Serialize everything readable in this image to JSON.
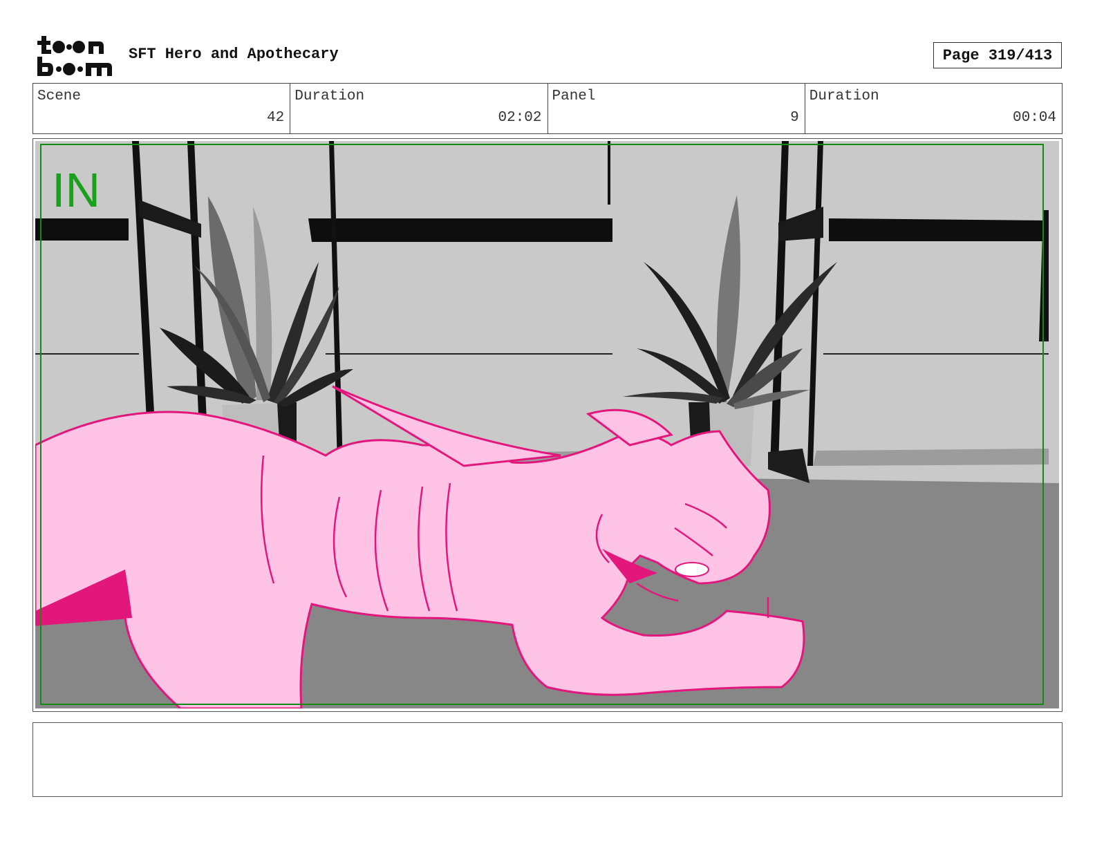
{
  "header": {
    "logo_text": "toon boom",
    "title": "SFT Hero and Apothecary",
    "page": "Page 319/413"
  },
  "info": {
    "scene_label": "Scene",
    "scene_value": "42",
    "scene_duration_label": "Duration",
    "scene_duration_value": "02:02",
    "panel_label": "Panel",
    "panel_value": "9",
    "panel_duration_label": "Duration",
    "panel_duration_value": "00:04"
  },
  "frame": {
    "transition_label": "IN",
    "safe_frame_color": "#138a13",
    "character_fill": "#ffc3e6",
    "character_line": "#e3167c"
  },
  "notes": {
    "text": ""
  }
}
